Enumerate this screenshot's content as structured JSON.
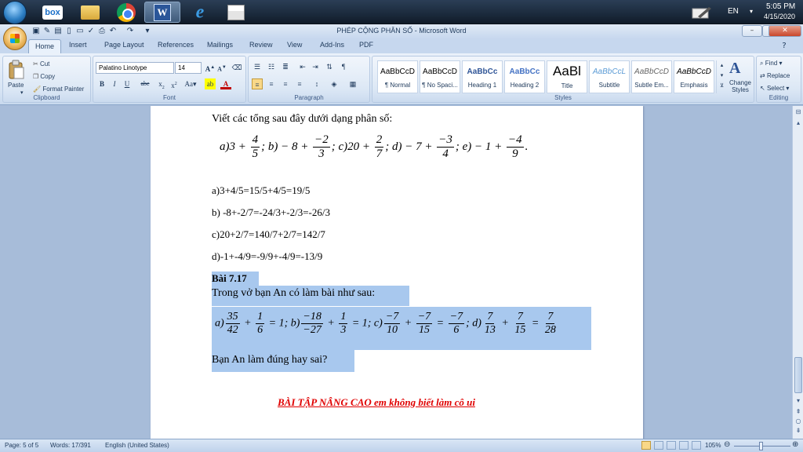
{
  "taskbar": {
    "apps": [
      {
        "name": "box",
        "label": "box"
      },
      {
        "name": "file-explorer"
      },
      {
        "name": "google-chrome"
      },
      {
        "name": "microsoft-word",
        "label": "W"
      },
      {
        "name": "internet-explorer",
        "label": "e"
      },
      {
        "name": "paint"
      }
    ],
    "language": "EN",
    "time": "5:05 PM",
    "date": "4/15/2020"
  },
  "window": {
    "title": "PHÉP CỘNG PHÂN SỐ - Microsoft Word"
  },
  "ribbon": {
    "tabs": [
      "Home",
      "Insert",
      "Page Layout",
      "References",
      "Mailings",
      "Review",
      "View",
      "Add-Ins",
      "PDF"
    ],
    "active_tab": "Home",
    "clipboard": {
      "paste": "Paste",
      "cut": "Cut",
      "copy": "Copy",
      "format_painter": "Format Painter",
      "label": "Clipboard"
    },
    "font": {
      "family": "Palatino Linotype",
      "size": "14",
      "label": "Font"
    },
    "paragraph": {
      "label": "Paragraph"
    },
    "styles": {
      "label": "Styles",
      "items": [
        {
          "sample": "AaBbCcD",
          "name": "¶ Normal"
        },
        {
          "sample": "AaBbCcD",
          "name": "¶ No Spaci..."
        },
        {
          "sample": "AaBbCc",
          "name": "Heading 1"
        },
        {
          "sample": "AaBbCc",
          "name": "Heading 2"
        },
        {
          "sample": "AaBl",
          "name": "Title"
        },
        {
          "sample": "AaBbCcL",
          "name": "Subtitle"
        },
        {
          "sample": "AaBbCcD",
          "name": "Subtle Em..."
        },
        {
          "sample": "AaBbCcD",
          "name": "Emphasis"
        }
      ],
      "change_styles": "Change Styles"
    },
    "editing": {
      "find": "Find",
      "replace": "Replace",
      "select": "Select",
      "label": "Editing"
    }
  },
  "document": {
    "intro": "Viết các tổng sau đây dưới dạng phân số:",
    "answers": [
      "a)3+4/5=15/5+4/5=19/5",
      "b) -8+-2/7=-24/3+-2/3=-26/3",
      "c)20+2/7=140/7+2/7=142/7",
      "d)-1+-4/9=-9/9+-4/9=-13/9"
    ],
    "heading": "Bài 7.17",
    "problem": "Trong vở bạn An có làm bài như sau:",
    "question": "Bạn An làm đúng hay sai?",
    "advanced": "BÀI TẬP NÂNG CAO em không biết làm cô ui"
  },
  "statusbar": {
    "page": "Page: 5 of 5",
    "words": "Words: 17/391",
    "language": "English (United States)",
    "zoom": "105%"
  }
}
